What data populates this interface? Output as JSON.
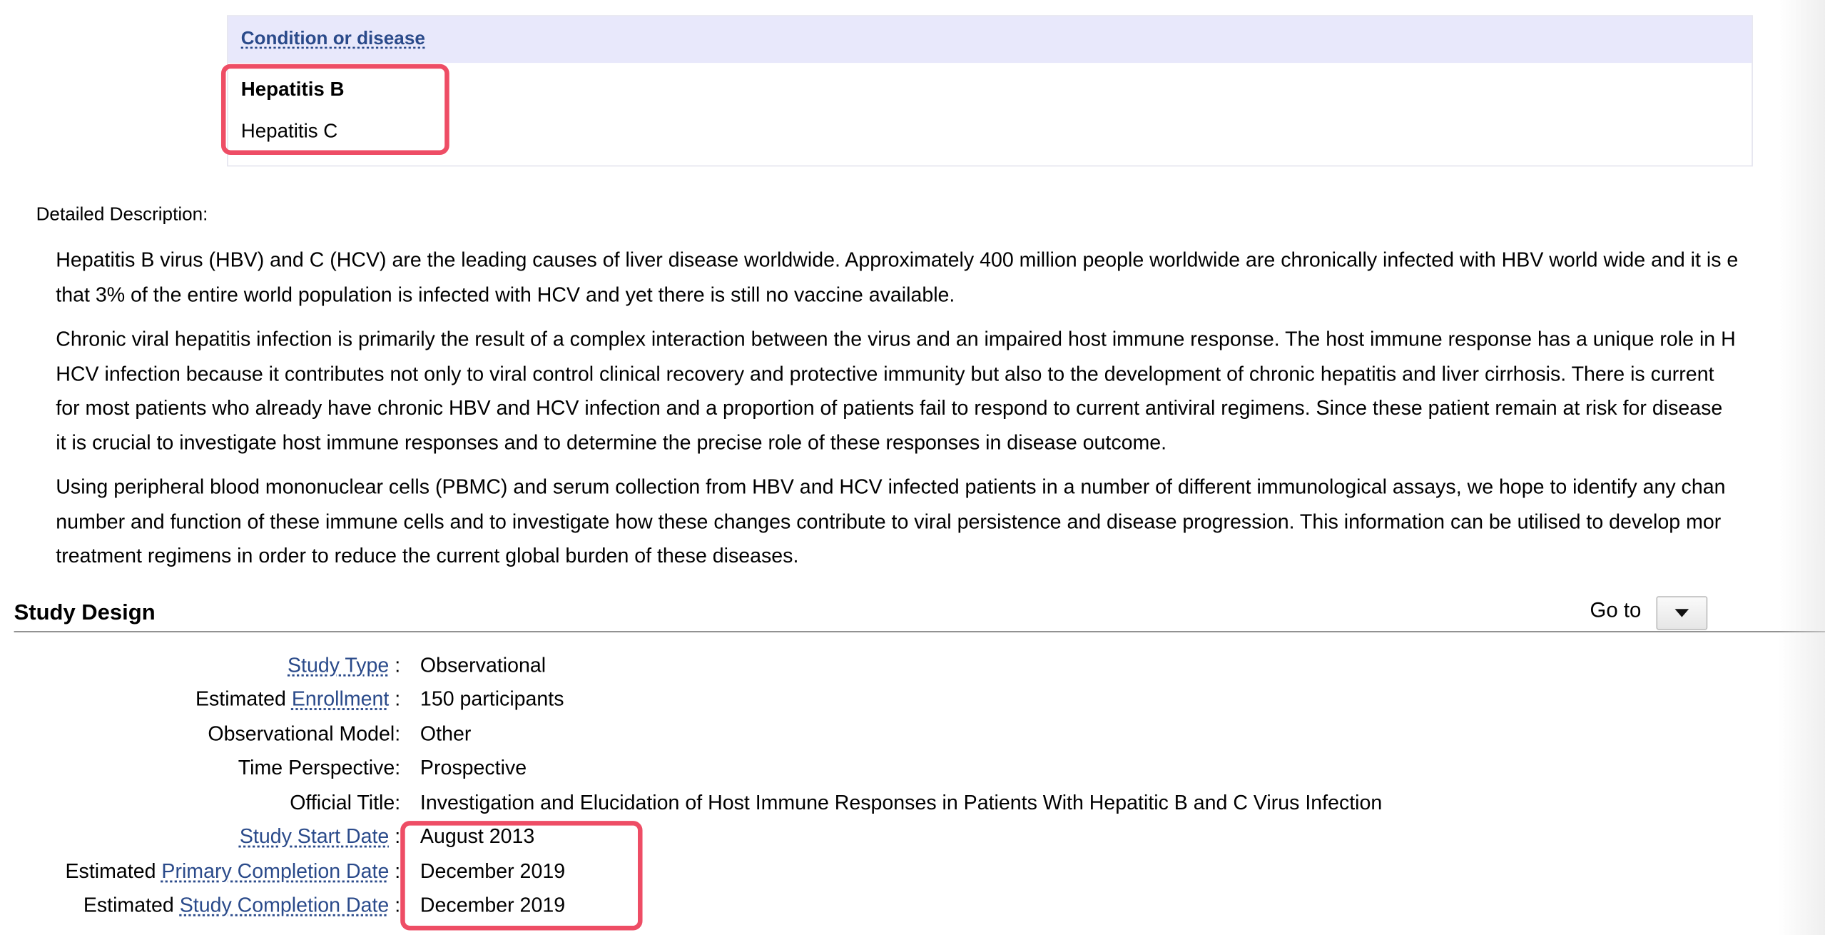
{
  "conditions": {
    "header": "Condition or disease",
    "items": [
      "Hepatitis B",
      "Hepatitis C"
    ]
  },
  "description": {
    "label": "Detailed Description:",
    "paragraphs": [
      [
        "Hepatitis B virus (HBV) and C (HCV) are the leading causes of liver disease worldwide. Approximately 400 million people worldwide are chronically infected with HBV world wide and it is e",
        "that 3% of the entire world population is infected with HCV and yet there is still no vaccine available."
      ],
      [
        "Chronic viral hepatitis infection is primarily the result of a complex interaction between the virus and an impaired host immune response. The host immune response has a unique role in H",
        "HCV infection because it contributes not only to viral control clinical recovery and protective immunity but also to the development of chronic hepatitis and liver cirrhosis. There is current",
        "for most patients who already have chronic HBV and HCV infection and a proportion of patients fail to respond to current antiviral regimens. Since these patient remain at risk for disease",
        "it is crucial to investigate host immune responses and to determine the precise role of these responses in disease outcome."
      ],
      [
        "Using peripheral blood mononuclear cells (PBMC) and serum collection from HBV and HCV infected patients in a number of different immunological assays, we hope to identify any chan",
        "number and function of these immune cells and to investigate how these changes contribute to viral persistence and disease progression. This information can be utilised to develop mor",
        "treatment regimens in order to reduce the current global burden of these diseases."
      ]
    ]
  },
  "study_design": {
    "title": "Study Design",
    "goto_label": "Go to",
    "rows": [
      {
        "prefix": "",
        "link": "Study Type",
        "suffix": " :",
        "value": "Observational"
      },
      {
        "prefix": "Estimated ",
        "link": "Enrollment",
        "suffix": " :",
        "value": "150 participants"
      },
      {
        "prefix": "Observational Model:",
        "link": "",
        "suffix": "",
        "value": "Other"
      },
      {
        "prefix": "Time Perspective:",
        "link": "",
        "suffix": "",
        "value": "Prospective"
      },
      {
        "prefix": "Official Title:",
        "link": "",
        "suffix": "",
        "value": "Investigation and Elucidation of Host Immune Responses in Patients With Hepatitic B and C Virus Infection"
      },
      {
        "prefix": "",
        "link": "Study Start Date",
        "suffix": " :",
        "value": "August 2013"
      },
      {
        "prefix": "Estimated ",
        "link": "Primary Completion Date",
        "suffix": " :",
        "value": "December 2019"
      },
      {
        "prefix": "Estimated ",
        "link": "Study Completion Date",
        "suffix": " :",
        "value": "December 2019"
      }
    ]
  },
  "colors": {
    "link": "#2a4a8a",
    "highlight": "#ee4d65",
    "table_header_bg": "#e8e8fb"
  }
}
